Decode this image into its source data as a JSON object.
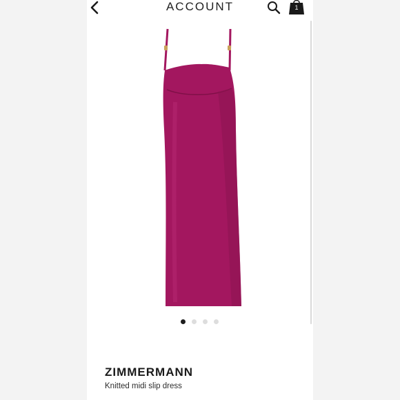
{
  "header": {
    "title": "ACCOUNT",
    "back_icon": "chevron-left-icon",
    "search_icon": "search-icon",
    "bag_icon": "shopping-bag-icon",
    "bag_count": "1"
  },
  "product": {
    "brand": "ZIMMERMANN",
    "name": "Knitted midi slip dress",
    "image": {
      "subject": "magenta knitted midi slip dress",
      "color": "#a3175f"
    }
  },
  "carousel": {
    "total": 4,
    "active_index": 0
  }
}
